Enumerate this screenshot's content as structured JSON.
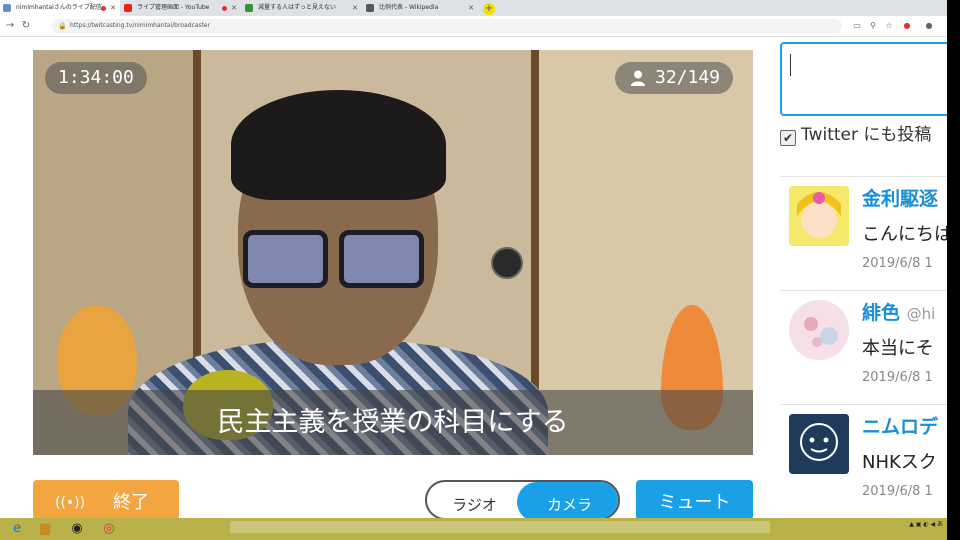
{
  "browser": {
    "tabs": [
      {
        "label": "nimimhantaiさんのライブ配信",
        "active": true,
        "favicon_color": "#5b8ed6"
      },
      {
        "label": "ライブ管理画面 - YouTube",
        "active": false,
        "favicon_color": "#e62117"
      },
      {
        "label": "減量する人はずっと見えない",
        "active": false,
        "favicon_color": "#3a8f3a"
      },
      {
        "label": "比例代表 - Wikipedia",
        "active": false,
        "favicon_color": "#555555"
      }
    ],
    "url": "https://twitcasting.tv/nimimhantai/broadcaster"
  },
  "broadcast": {
    "elapsed": "1:34:00",
    "viewers": "32/149",
    "subtitle": "民主主義を授業の科目にする"
  },
  "controls": {
    "end_label": "終了",
    "end_icon": "((•))",
    "radio_label": "ラジオ",
    "camera_label": "カメラ",
    "mute_label": "ミュート"
  },
  "sidebar": {
    "twitter_label": "Twitter にも投稿",
    "comments": [
      {
        "name": "金利駆逐",
        "handle": "",
        "text": "こんにちは",
        "time": "2019/6/8 1"
      },
      {
        "name": "緋色",
        "handle": "@hi",
        "text": "本当にそ",
        "time": "2019/6/8 1"
      },
      {
        "name": "ニムロデ",
        "handle": "",
        "text": "NHKスク",
        "time": "2019/6/8 1"
      }
    ]
  },
  "colors": {
    "accent": "#1aa0e6",
    "end_button": "#f3a53f",
    "link": "#1a8fd6"
  }
}
